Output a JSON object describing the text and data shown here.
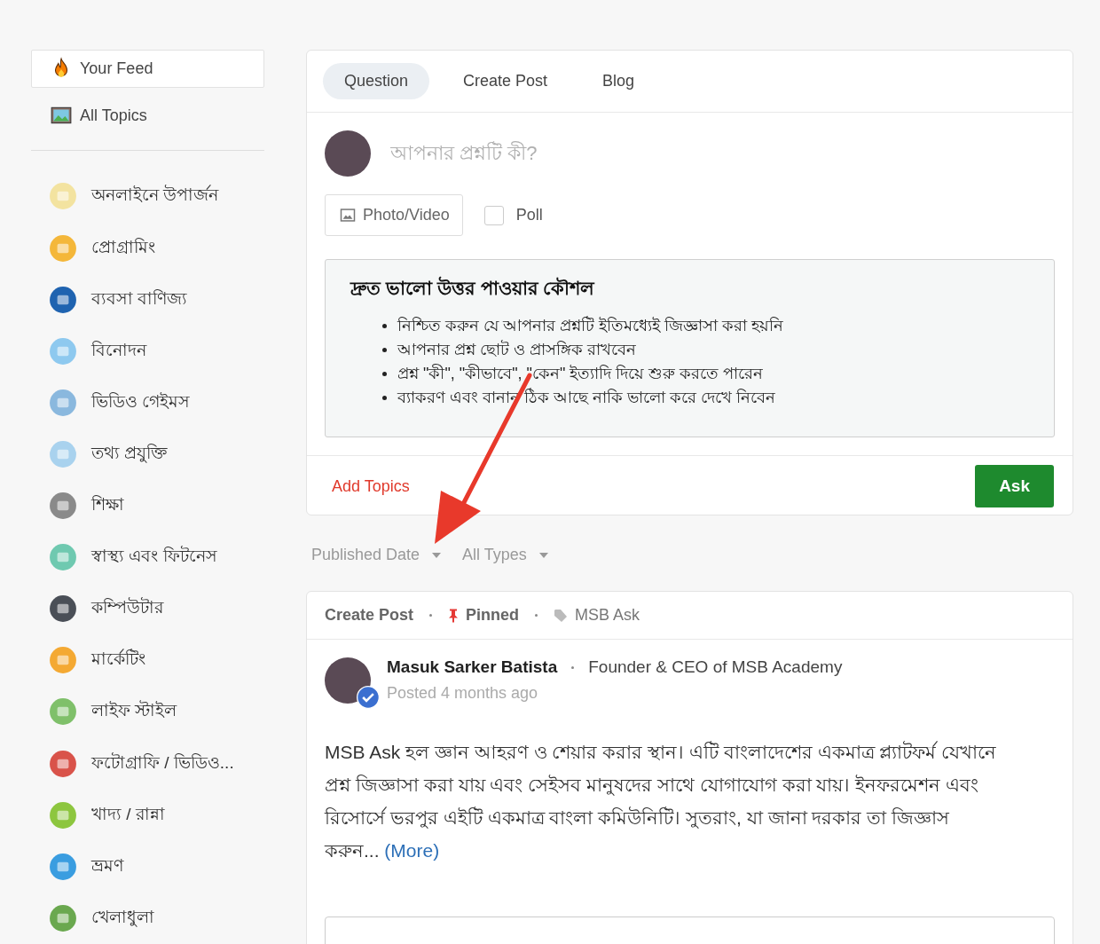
{
  "sidebar": {
    "primary": [
      {
        "label": "Your Feed",
        "selected": true,
        "kind": "flame"
      },
      {
        "label": "All Topics",
        "selected": false,
        "kind": "picture"
      }
    ],
    "topics": [
      {
        "label": "অনলাইনে উপার্জন",
        "color": "#f3e3a0"
      },
      {
        "label": "প্রোগ্রামিং",
        "color": "#f4b73a"
      },
      {
        "label": "ব্যবসা বাণিজ্য",
        "color": "#1f63b0"
      },
      {
        "label": "বিনোদন",
        "color": "#8ec9ef"
      },
      {
        "label": "ভিডিও গেইমস",
        "color": "#8ab8de"
      },
      {
        "label": "তথ্য প্রযুক্তি",
        "color": "#a9d2ee"
      },
      {
        "label": "শিক্ষা",
        "color": "#8a8a8a"
      },
      {
        "label": "স্বাস্থ্য এবং ফিটনেস",
        "color": "#6fc9b0"
      },
      {
        "label": "কম্পিউটার",
        "color": "#4a4f57"
      },
      {
        "label": "মার্কেটিং",
        "color": "#f4a933"
      },
      {
        "label": "লাইফ স্টাইল",
        "color": "#7fc06a"
      },
      {
        "label": "ফটোগ্রাফি / ভিডিও...",
        "color": "#d9534a"
      },
      {
        "label": "খাদ্য / রান্না",
        "color": "#8dc63f"
      },
      {
        "label": "ভ্রমণ",
        "color": "#3a9de0"
      },
      {
        "label": "খেলাধুলা",
        "color": "#6aa84f"
      }
    ]
  },
  "composer": {
    "tabs": [
      {
        "label": "Question",
        "selected": true
      },
      {
        "label": "Create Post",
        "selected": false
      },
      {
        "label": "Blog",
        "selected": false
      }
    ],
    "question": {
      "placeholder": "আপনার প্রশ্নটি কী?"
    },
    "attach_button": "Photo/Video",
    "poll": {
      "label": "Poll",
      "checked": false
    },
    "tips": {
      "title": "দ্রুত ভালো উত্তর পাওয়ার কৌশল",
      "items": [
        "নিশ্চিত করুন যে আপনার প্রশ্নটি ইতিমধ্যেই জিজ্ঞাসা করা হয়নি",
        "আপনার প্রশ্ন ছোট ও প্রাসঙ্গিক রাখবেন",
        "প্রশ্ন \"কী\", \"কীভাবে\", \"কেন\" ইত্যাদি দিয়ে শুরু করতে পারেন",
        "ব্যাকরণ এবং বানান ঠিক আছে নাকি ভালো করে দেখে নিবেন"
      ]
    },
    "add_topics": "Add Topics",
    "ask_button": "Ask"
  },
  "filters": [
    "Published Date",
    "All Types"
  ],
  "post": {
    "type": "Create Post",
    "pinned": "Pinned",
    "tag": "MSB Ask",
    "author": {
      "name": "Masuk Sarker Batista",
      "verified": true,
      "role": "Founder & CEO of MSB Academy"
    },
    "posted": "Posted 4 months ago",
    "body": "MSB Ask হল জ্ঞান আহরণ ও শেয়ার করার স্থান। এটি বাংলাদেশের একমাত্র প্ল্যাটফর্ম যেখানে প্রশ্ন জিজ্ঞাসা করা যায় এবং সেইসব মানুষদের সাথে যোগাযোগ করা যায়। ইনফরমেশন এবং রিসোর্সে ভরপুর এইটি একমাত্র বাংলা কমিউনিটি। সুতরাং, যা জানা দরকার তা জিজ্ঞাস করুন...",
    "more": "(More)"
  }
}
